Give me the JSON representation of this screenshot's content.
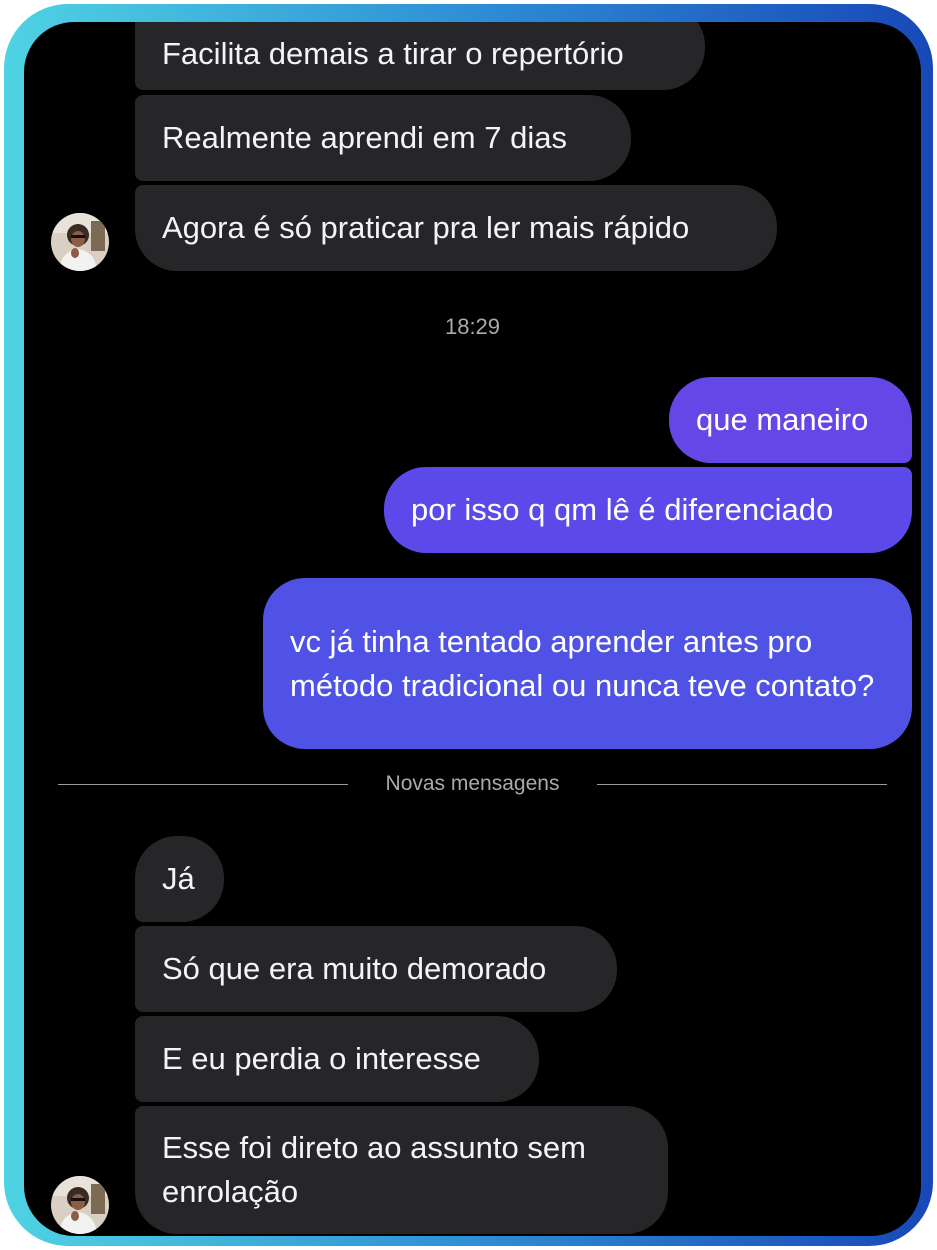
{
  "chat": {
    "messages_before": [
      "Facilita demais a tirar o repertório",
      "Realmente aprendi em 7 dias",
      "Agora é só praticar pra ler mais rápido"
    ],
    "timestamp": "18:29",
    "outgoing": [
      "que maneiro",
      "por isso q qm lê é diferenciado",
      "vc já tinha tentado aprender antes pro método tradicional ou nunca teve contato?"
    ],
    "divider_label": "Novas mensagens",
    "messages_after": [
      "Já",
      "Só que era muito demorado",
      "E eu perdia o interesse",
      "Esse foi direto ao assunto sem enrolação"
    ]
  },
  "colors": {
    "frame_gradient_start": "#4fd3e3",
    "frame_gradient_end": "#1848b8",
    "incoming_bubble": "#262628",
    "outgoing_bubble": "#5b4ae9",
    "background": "#000000"
  },
  "icons": {
    "avatar": "contact-avatar"
  }
}
